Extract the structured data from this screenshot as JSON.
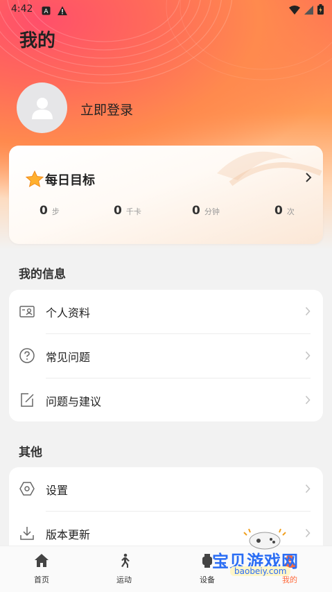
{
  "status_bar": {
    "time": "4:42"
  },
  "header": {
    "title": "我的"
  },
  "profile": {
    "login_label": "立即登录"
  },
  "daily_goal": {
    "title": "每日目标",
    "stats": [
      {
        "value": "0",
        "unit": "步"
      },
      {
        "value": "0",
        "unit": "千卡"
      },
      {
        "value": "0",
        "unit": "分钟"
      },
      {
        "value": "0",
        "unit": "次"
      }
    ]
  },
  "my_info": {
    "title": "我的信息",
    "items": [
      {
        "label": "个人资料",
        "icon": "id-card-icon"
      },
      {
        "label": "常见问题",
        "icon": "question-circle-icon"
      },
      {
        "label": "问题与建议",
        "icon": "edit-note-icon"
      }
    ]
  },
  "other": {
    "title": "其他",
    "items": [
      {
        "label": "设置",
        "icon": "hexagon-settings-icon"
      },
      {
        "label": "版本更新",
        "icon": "download-icon"
      }
    ]
  },
  "tabbar": {
    "tabs": [
      {
        "label": "首页",
        "icon": "home-icon"
      },
      {
        "label": "运动",
        "icon": "running-icon"
      },
      {
        "label": "设备",
        "icon": "watch-icon"
      },
      {
        "label": "我的",
        "icon": "profile-icon",
        "active": true
      }
    ]
  },
  "watermark": {
    "text": "宝贝游戏网",
    "sub": "baobeiy.com"
  },
  "colors": {
    "accent": "#ff6b3d",
    "hero_start": "#ff4f6a",
    "hero_end": "#ff9b55"
  }
}
